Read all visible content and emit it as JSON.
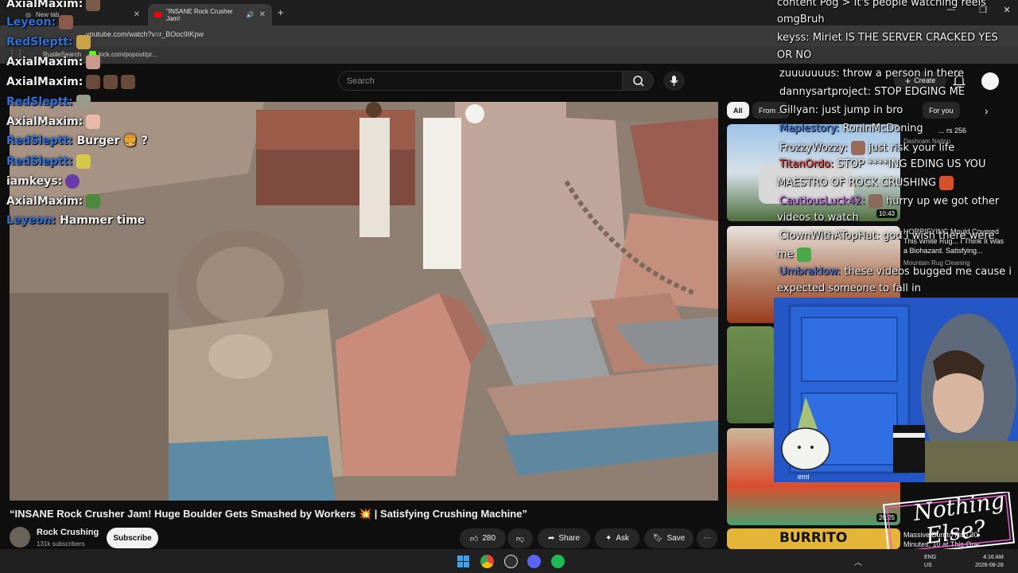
{
  "browser": {
    "tabs": [
      {
        "label": "New tab"
      },
      {
        "label": "\"INSANE Rock Crusher Jam!"
      }
    ],
    "url": "youtube.com/watch?v=r_BOoc9IKpw",
    "bookmarks": [
      "RustleSearch",
      "kick.com/popout/pr..."
    ]
  },
  "youtube": {
    "search_placeholder": "Search",
    "create_label": "Create",
    "video": {
      "title": "“INSANE Rock Crusher Jam! Huge Boulder Gets Smashed by Workers 💥 | Satisfying Crushing Machine”",
      "channel": "Rock Crushing",
      "subscribers": "131k subscribers",
      "subscribe_label": "Subscribe",
      "likes": "280",
      "share_label": "Share",
      "ask_label": "Ask",
      "save_label": "Save"
    },
    "chips": [
      "All",
      "From ...",
      "For you"
    ],
    "recommended": [
      {
        "title": "... rs 256",
        "channel": "Dashcam Nation",
        "duration": "10:43"
      },
      {
        "title": "HORRIFYING Mould Covered This White Rug... I Think It Was a Biohazard. Satisfying...",
        "channel": "Mountain Rug Cleaning",
        "duration": ""
      },
      {
        "title": "",
        "channel": "",
        "duration": ""
      },
      {
        "title": "",
        "channel": "",
        "duration": "26:25"
      },
      {
        "title": "Massive Burrito Rug 30 Minutes, 10 at This One",
        "channel": "",
        "duration": ""
      }
    ]
  },
  "left_chat": [
    {
      "name": "AxialMaxim:",
      "msg": "",
      "color": "white"
    },
    {
      "name": "Leyeon:",
      "msg": "",
      "color": "blue"
    },
    {
      "name": "RedSleptt:",
      "msg": "",
      "color": "blue"
    },
    {
      "name": "AxialMaxim:",
      "msg": "",
      "color": "white"
    },
    {
      "name": "AxialMaxim:",
      "msg": "",
      "color": "white"
    },
    {
      "name": "RedSleptt:",
      "msg": "",
      "color": "blue"
    },
    {
      "name": "AxialMaxim:",
      "msg": "",
      "color": "white"
    },
    {
      "name": "RedSleptt:",
      "msg": "Burger 🍔 ?",
      "color": "blue"
    },
    {
      "name": "RedSleptt:",
      "msg": "",
      "color": "blue"
    },
    {
      "name": "iamkeys:",
      "msg": "",
      "color": "white"
    },
    {
      "name": "AxialMaxim:",
      "msg": "",
      "color": "white"
    },
    {
      "name": "Leyeon:",
      "msg": "Hammer time",
      "color": "blue"
    }
  ],
  "right_chat": [
    {
      "name": "",
      "msg": "content Pog > It's people watching reels"
    },
    {
      "name": "",
      "msg": "omgBruh"
    },
    {
      "name": "keyss:",
      "msg": "Miriet IS THE SERVER CRACKED YES",
      "color": "white"
    },
    {
      "name": "",
      "msg": "OR NO"
    },
    {
      "name": "zuuuuuuus:",
      "msg": "throw a person in there",
      "color": "white"
    },
    {
      "name": "dannysartproject:",
      "msg": "STOP EDGING ME",
      "color": "white"
    },
    {
      "name": "Gillyan:",
      "msg": "just jump in bro",
      "color": "white"
    },
    {
      "name": "Maplestory:",
      "msg": "RoninMcDoning",
      "color": "blue"
    },
    {
      "name": "FrozzyWozzy:",
      "msg": "just risk your life",
      "color": "white"
    },
    {
      "name": "TitanOrdo:",
      "msg": "STOP ****ING EDING US YOU",
      "color": "red"
    },
    {
      "name": "",
      "msg": "MAESTRO OF ROCK CRUSHING"
    },
    {
      "name": "CautiousLuck42:",
      "msg": "hurry up we got other",
      "color": "purple"
    },
    {
      "name": "",
      "msg": "videos to watch"
    },
    {
      "name": "ClownWithATopHat:",
      "msg": "god I wish there were",
      "color": "white"
    },
    {
      "name": "",
      "msg": "me"
    },
    {
      "name": "Umbraklow:",
      "msg": "these videos bugged me cause i",
      "color": "blue"
    },
    {
      "name": "",
      "msg": "expected someone to fall in"
    }
  ],
  "webcam_label": "emi",
  "logo_text": [
    "Nothing",
    "Else?"
  ],
  "taskbar": {
    "time": "4:16 AM",
    "date": "2026-08-28",
    "lang1": "ENG",
    "lang2": "US"
  }
}
